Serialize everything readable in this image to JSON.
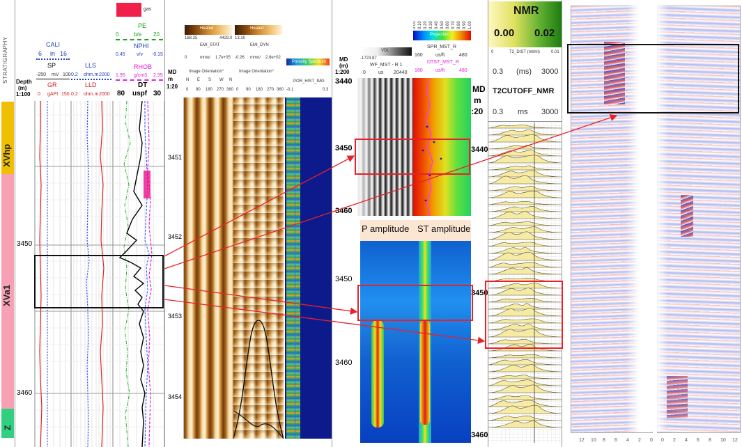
{
  "strat": {
    "header": "STRATIGRAPHY",
    "zones": [
      {
        "label": "XVhp",
        "color": "#f0c000"
      },
      {
        "label": "XVa1",
        "color": "#f8a0b4"
      },
      {
        "label": "Z",
        "color": "#30d080"
      }
    ]
  },
  "track1": {
    "depth_label": "Depth",
    "depth_unit": "(m)",
    "depth_scale": "1:100",
    "cali": {
      "name": "CALI",
      "min": "6",
      "unit": "in",
      "max": "16"
    },
    "sp": {
      "name": "SP",
      "min": "-250",
      "unit": "mV",
      "max": "100"
    },
    "gr": {
      "name": "GR",
      "min": "0",
      "unit": "gAPI",
      "max": "150"
    },
    "lls": {
      "name": "LLS",
      "min": "0.2",
      "unit": "ohm.m",
      "max": "2000"
    },
    "lld": {
      "name": "LLD",
      "min": "0.2",
      "unit": "ohm.m",
      "max": "2000"
    },
    "pe": {
      "name": "PE",
      "min": "0",
      "unit": "b/e",
      "max": "20"
    },
    "nphi": {
      "name": "NPHI",
      "min": "0.45",
      "unit": "v/v",
      "max": "-0.15"
    },
    "rhob": {
      "name": "RHOB",
      "min": "1.95",
      "unit": "g/cm3",
      "max": "2.95"
    },
    "dt": {
      "name": "DT",
      "min": "80",
      "unit": "uspf",
      "max": "30"
    },
    "gas_label": "gas",
    "depths": [
      "3450",
      "3460"
    ]
  },
  "track2": {
    "md_label": "MD",
    "md_unit": "m",
    "md_scale": "1:20",
    "stat": {
      "name": "EMI_STAT",
      "title": "Heated",
      "min": "188.25",
      "max": "4429.0",
      "scale_min": "0",
      "unit": "mmo/",
      "scale_max": "1.7e+05",
      "orient": "Image Orientation°",
      "ticks": [
        "0",
        "90",
        "180",
        "270",
        "360"
      ]
    },
    "dyn": {
      "name": "EMI_DYN",
      "title": "Heated",
      "min": "13.10",
      "max": "",
      "scale_min": "-0.26",
      "unit": "mmo/",
      "scale_max": "2.8e+02",
      "orient": "Image Orientation°",
      "ticks": [
        "0",
        "90",
        "180",
        "270",
        "360"
      ]
    },
    "spectrum": {
      "name": "POR_HIST_IMG",
      "title": "Porosity Spectrum",
      "ticks": [
        "-0.1",
        "0.3"
      ]
    },
    "depths": [
      "3451",
      "3452",
      "3453",
      "3454"
    ],
    "compass": [
      "N",
      "E",
      "S",
      "W",
      "N"
    ]
  },
  "track3": {
    "md_label": "MD",
    "md_unit": "(m)",
    "md_scale": "1:200",
    "wf": {
      "name": "WF_MST - R 1",
      "vdl": "VDL",
      "min": "-1723.87",
      "scale_min": "0",
      "unit": "us",
      "scale_max": "20440"
    },
    "spr": {
      "name": "SPR_MST_R",
      "proj": "Projection",
      "ticks": [
        "0.00",
        "0.10",
        "0.20",
        "0.30",
        "0.40",
        "0.50",
        "0.60",
        "0.70",
        "0.80",
        "0.90",
        "1.00"
      ],
      "min": "160",
      "unit": "us/ft",
      "max": "480"
    },
    "dtst": {
      "name": "DTST_MST_R",
      "min": "160",
      "unit": "us/ft",
      "max": "480"
    },
    "depths_top": [
      "3440",
      "3450",
      "3460"
    ],
    "p_amp": "P amplitude",
    "st_amp": "ST amplitude",
    "depths_bottom": [
      "3450",
      "3460"
    ]
  },
  "track4": {
    "md_label": "MD",
    "md_unit": "m",
    "md_scale": ":20",
    "depths": [
      "3440",
      "3450",
      "3460"
    ]
  },
  "nmr": {
    "title": "NMR",
    "val_left": "0.00",
    "val_right": "0.02",
    "t2dist_min": "0",
    "t2dist_name": "T2_DIST (ml/ml)",
    "t2dist_max": "0.01",
    "row1_min": "0.3",
    "row1_unit": "(ms)",
    "row1_max": "3000",
    "cutoff": "T2CUTOFF_NMR",
    "row2_min": "0.3",
    "row2_unit": "ms",
    "row2_max": "3000"
  },
  "seismic": {
    "bottom_ticks_left": [
      "12",
      "10",
      "8",
      "6",
      "4",
      "2",
      "0"
    ],
    "bottom_ticks_right": [
      "0",
      "2",
      "4",
      "6",
      "8",
      "10",
      "12"
    ]
  },
  "colors": {
    "red_box": "#e8202a",
    "black_box": "#111111",
    "arrow": "#e8202a"
  }
}
